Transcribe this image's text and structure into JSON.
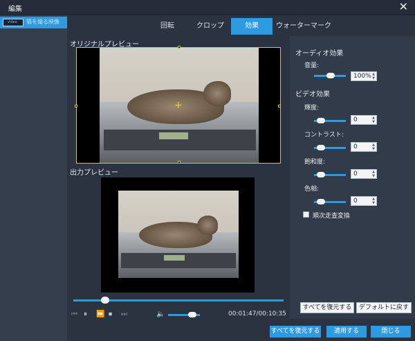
{
  "window": {
    "title": "編集",
    "close_glyph": "✕"
  },
  "sidebar": {
    "items": [
      {
        "label": "猫を撮る映像",
        "thumb_text": "video"
      }
    ]
  },
  "tabs": [
    {
      "label": "回転",
      "active": false
    },
    {
      "label": "クロップ",
      "active": false
    },
    {
      "label": "効果",
      "active": true
    },
    {
      "label": "ウォーターマーク",
      "active": false
    }
  ],
  "preview": {
    "original_label": "オリジナルプレビュー",
    "output_label": "出力プレビュー"
  },
  "playback": {
    "progress": 0.15,
    "volume": 0.75,
    "time": "00:01:47/00:10:35",
    "icons": {
      "prev": "skip-back-icon",
      "pause": "pause-icon",
      "forward": "fast-forward-icon",
      "stop": "stop-icon",
      "next": "skip-forward-icon",
      "volume": "volume-icon"
    }
  },
  "effects": {
    "audio_heading": "オーディオ効果",
    "volume_label": "音量:",
    "volume_value": "100%",
    "video_heading": "ビデオ効果",
    "brightness_label": "輝度:",
    "brightness_value": "0",
    "contrast_label": "コントラスト:",
    "contrast_value": "0",
    "saturation_label": "飽和度:",
    "saturation_value": "0",
    "hue_label": "色相:",
    "hue_value": "0",
    "deinterlace_label": "順次走査変換",
    "restore_all_label": "すべてを復元する",
    "default_label": "デフォルトに戻す"
  },
  "footer": {
    "restore_all_label": "すべてを復元する",
    "apply_label": "適用する",
    "close_label": "閉じる"
  },
  "colors": {
    "accent": "#2e9be0",
    "background": "#2b3340",
    "crop_border": "#d8c53a"
  }
}
